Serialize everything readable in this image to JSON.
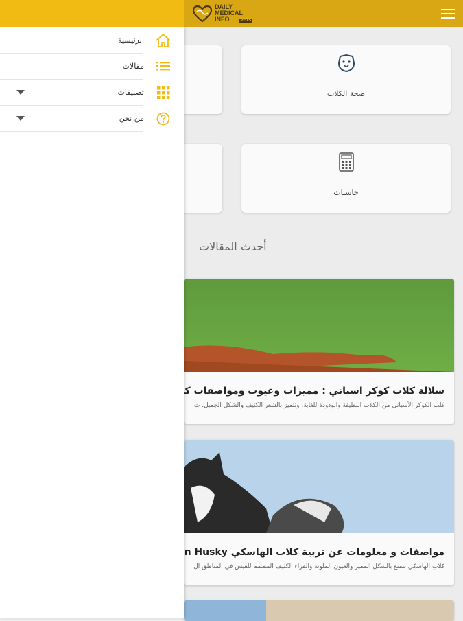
{
  "header": {
    "logo_line1": "DAILY",
    "logo_line2": "MEDICAL",
    "logo_line3": "INFO",
    "logo_badge": "PETS"
  },
  "drawer": {
    "items": [
      {
        "label": "الرئيسية",
        "icon": "home-icon"
      },
      {
        "label": "مقالات",
        "icon": "list-icon"
      },
      {
        "label": "تصنيفات",
        "icon": "grid-icon",
        "expandable": true
      },
      {
        "label": "من نحن",
        "icon": "help-circle-icon",
        "expandable": true
      }
    ]
  },
  "cards": [
    {
      "label": "صحة الكلاب",
      "icon": "dog-health-icon"
    },
    {
      "label": "حاسبات",
      "icon": "calculator-icon"
    }
  ],
  "latest_title": "أحدث المقالات",
  "articles": [
    {
      "title": "سلالة كلاب كوكر اسباني : مميزات وعيوب ومواصفات كلب",
      "excerpt": "كلب الكوكر الأسباني من الكلاب اللطيفة والودودة للغاية، وتتميز بالشعر الكثيف والشكل الجميل، ت"
    },
    {
      "title": "مواصفات و معلومات عن تربية كلاب الهاسكي an Husky",
      "excerpt": "كلاب الهاسكي تتمتع بالشكل المميز والعيون الملونة والفراء الكثيف المصمم للعيش في المناطق ال"
    }
  ],
  "colors": {
    "appbar": "#d8a713",
    "drawer_header": "#f2bb14",
    "icon_accent": "#f2bb14"
  }
}
